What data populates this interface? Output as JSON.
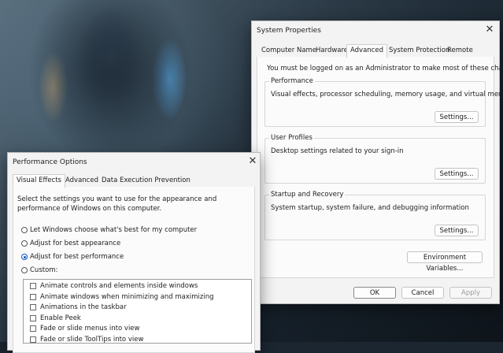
{
  "system_properties": {
    "title": "System Properties",
    "tabs": [
      "Computer Name",
      "Hardware",
      "Advanced",
      "System Protection",
      "Remote"
    ],
    "active_tab": "Advanced",
    "admin_note": "You must be logged on as an Administrator to make most of these changes.",
    "performance": {
      "legend": "Performance",
      "description": "Visual effects, processor scheduling, memory usage, and virtual memory",
      "button": "Settings..."
    },
    "user_profiles": {
      "legend": "User Profiles",
      "description": "Desktop settings related to your sign-in",
      "button": "Settings..."
    },
    "startup_recovery": {
      "legend": "Startup and Recovery",
      "description": "System startup, system failure, and debugging information",
      "button": "Settings..."
    },
    "env_button": "Environment Variables...",
    "ok": "OK",
    "cancel": "Cancel",
    "apply": "Apply"
  },
  "performance_options": {
    "title": "Performance Options",
    "tabs": [
      "Visual Effects",
      "Advanced",
      "Data Execution Prevention"
    ],
    "active_tab": "Visual Effects",
    "intro_line1": "Select the settings you want to use for the appearance and",
    "intro_line2": "performance of Windows on this computer.",
    "radio_options": [
      {
        "label": "Let Windows choose what's best for my computer",
        "checked": false
      },
      {
        "label": "Adjust for best appearance",
        "checked": false
      },
      {
        "label": "Adjust for best performance",
        "checked": true
      },
      {
        "label": "Custom:",
        "checked": false
      }
    ],
    "effects": [
      {
        "label": "Animate controls and elements inside windows",
        "checked": false
      },
      {
        "label": "Animate windows when minimizing and maximizing",
        "checked": false
      },
      {
        "label": "Animations in the taskbar",
        "checked": false
      },
      {
        "label": "Enable Peek",
        "checked": false
      },
      {
        "label": "Fade or slide menus into view",
        "checked": false
      },
      {
        "label": "Fade or slide ToolTips into view",
        "checked": false
      }
    ]
  },
  "colors": {
    "accent": "#0b57c9"
  }
}
